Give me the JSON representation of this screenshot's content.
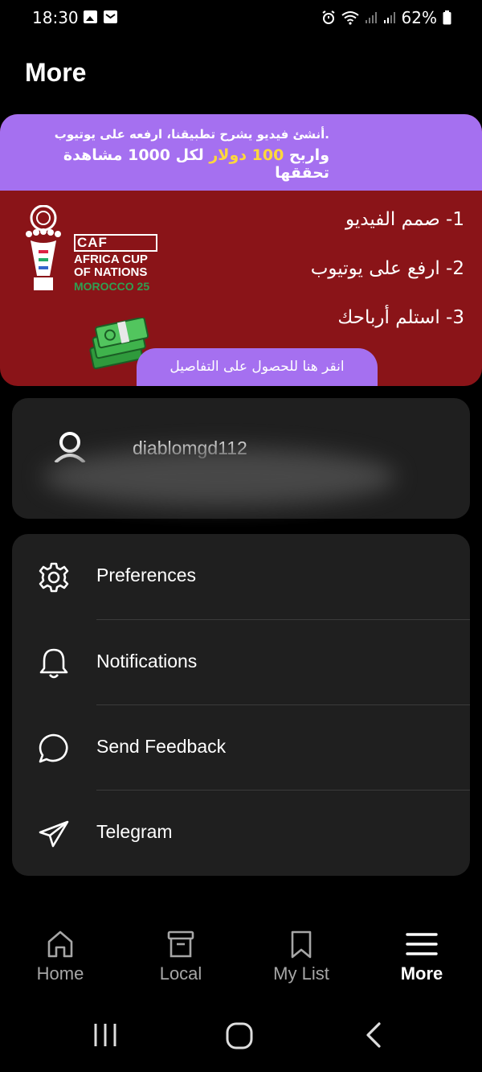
{
  "status_bar": {
    "time": "18:30",
    "battery": "62%",
    "left_icons": [
      "image-icon",
      "mail-icon"
    ],
    "right_icons": [
      "alarm-icon",
      "wifi-icon",
      "signal-icon",
      "signal-icon",
      "battery-icon"
    ]
  },
  "page": {
    "title": "More"
  },
  "promo": {
    "line1": ".أنشئ فيديو يشرح تطبيقنا، ارفعه على يوتيوب",
    "line2_pre": "واربح ",
    "line2_highlight": "100 دولار",
    "line2_post": " لكل 1000 مشاهدة تحققها",
    "steps": [
      "1- صمم الفيديو",
      "2- ارفع على يوتيوب",
      "3- استلم أرباحك"
    ],
    "logo": {
      "brand": "CAF",
      "name_line1": "AFRICA CUP",
      "name_line2": "OF NATIONS",
      "edition": "MOROCCO 25"
    },
    "cta": "انقر هنا للحصول على التفاصيل",
    "colors": {
      "top": "#a570f0",
      "bottom": "#8a1418",
      "highlight": "#ffd83b"
    }
  },
  "account": {
    "username": "diablomgd112",
    "icon": "user-icon"
  },
  "menu": {
    "items": [
      {
        "label": "Preferences",
        "icon": "gear-icon"
      },
      {
        "label": "Notifications",
        "icon": "bell-icon"
      },
      {
        "label": "Send Feedback",
        "icon": "chat-bubble-icon"
      },
      {
        "label": "Telegram",
        "icon": "telegram-icon"
      }
    ]
  },
  "bottom_nav": {
    "items": [
      {
        "label": "Home",
        "icon": "home-icon",
        "active": false
      },
      {
        "label": "Local",
        "icon": "archive-icon",
        "active": false
      },
      {
        "label": "My List",
        "icon": "bookmark-icon",
        "active": false
      },
      {
        "label": "More",
        "icon": "menu-icon",
        "active": true
      }
    ]
  },
  "system_nav": [
    "recents-icon",
    "home-circle-icon",
    "back-icon"
  ]
}
